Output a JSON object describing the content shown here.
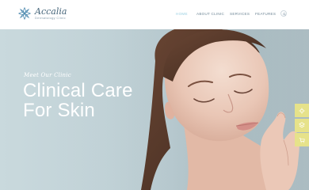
{
  "brand": {
    "name": "Accalia",
    "tagline": "Dermatology Clinic",
    "logo_icon": "flower-icon",
    "accent_color": "#4f8bb0"
  },
  "nav": {
    "items": [
      {
        "label": "HOME",
        "active": true
      },
      {
        "label": "ABOUT CLINIC",
        "active": false
      },
      {
        "label": "SERVICES",
        "active": false
      },
      {
        "label": "FEATURES",
        "active": false
      }
    ],
    "search_icon": "search-icon"
  },
  "hero": {
    "kicker": "Meet Our Clinic",
    "title_line1": "Clinical Care",
    "title_line2": "For Skin"
  },
  "side_panel": {
    "buttons": [
      {
        "icon": "gear-icon"
      },
      {
        "icon": "layers-icon"
      },
      {
        "icon": "cart-icon"
      }
    ],
    "color": "#e6e28a"
  }
}
